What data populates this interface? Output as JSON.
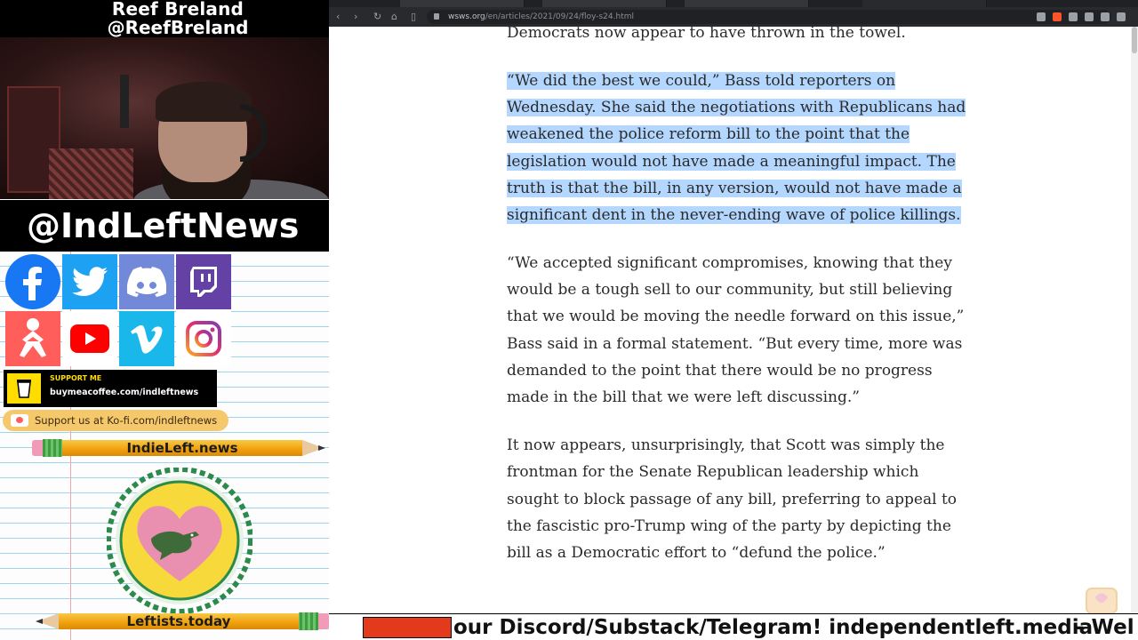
{
  "overlay": {
    "streamer_name": "Reef Breland",
    "streamer_handle": "@ReefBreland",
    "brand_handle": "@IndLeftNews",
    "social_icons": [
      "facebook-icon",
      "twitter-icon",
      "discord-icon",
      "twitch-icon",
      "kofi-icon",
      "youtube-icon",
      "vimeo-icon",
      "instagram-icon"
    ],
    "buymeacoffee": {
      "label": "SUPPORT ME",
      "url": "buymeacoffee.com/indleftnews"
    },
    "kofi_text": "Support us at Ko-fi.com/indleftnews",
    "pencil_top_label": "IndieLeft.news",
    "pencil_bottom_label": "Leftists.today"
  },
  "browser": {
    "url_host": "wsws.org",
    "url_path": "/en/articles/2021/09/24/floy-s24.html"
  },
  "article": {
    "p0": "Democrats now appear to have thrown in the towel.",
    "p1": "“We did the best we could,” Bass told reporters on Wednesday. She said the negotiations with Republicans had weakened the police reform bill to the point that the legislation would not have made a meaningful impact. The truth is that the bill, in any version, would not have made a significant dent in the never-ending wave of police killings.",
    "p2": "“We accepted significant compromises, knowing that they would be a tough sell to our community, but still believing that we would be moving the needle forward on this issue,” Bass said in a formal statement. “But every time, more was demanded to the point that there would be no progress made in the bill that we were left discussing.”",
    "p3": "It now appears, unsurprisingly, that Scott was simply the frontman for the Senate Republican leadership which sought to block passage of any bill, preferring to appeal to the fascistic pro-Trump wing of the party by depicting the bill as a Democratic effort to “defund the police.”"
  },
  "ticker": {
    "text": "our Discord/Substack/Telegram! independentleft.media",
    "text2": "- Wel"
  },
  "colors": {
    "highlight": "#b4d7ff",
    "ticker_red": "#e23a1a",
    "pencil_yellow": "#f2a20f",
    "heart_pink": "#e98fb0",
    "badge_yellow": "#f7d93c",
    "badge_green": "#2c8a4a"
  }
}
